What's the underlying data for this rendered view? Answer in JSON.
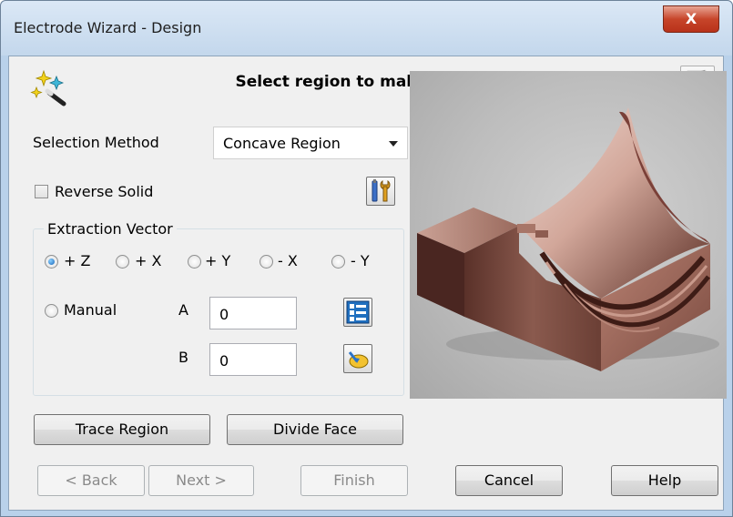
{
  "window": {
    "title": "Electrode Wizard - Design",
    "close_label": "X"
  },
  "header": {
    "title": "Select region to make electrode",
    "icons": [
      "wizard-wand-icon",
      "exit-door-icon"
    ]
  },
  "selection": {
    "label": "Selection Method",
    "value": "Concave Region"
  },
  "reverse_solid": {
    "label": "Reverse Solid",
    "checked": false
  },
  "extraction": {
    "group_label": "Extraction Vector",
    "options": [
      "+ Z",
      "+ X",
      "+ Y",
      "- X",
      "- Y"
    ],
    "selected": "+ Z",
    "manual_label": "Manual",
    "a_label": "A",
    "a_value": "0",
    "b_label": "B",
    "b_value": "0"
  },
  "actions": {
    "trace_region": "Trace Region",
    "divide_face": "Divide Face"
  },
  "footer": {
    "back": "< Back",
    "next": "Next >",
    "finish": "Finish",
    "cancel": "Cancel",
    "help": "Help"
  },
  "colors": {
    "accent_radio": "#1664b8",
    "close_button": "#c7452a",
    "electrode_copper": "#8a5a4e"
  }
}
